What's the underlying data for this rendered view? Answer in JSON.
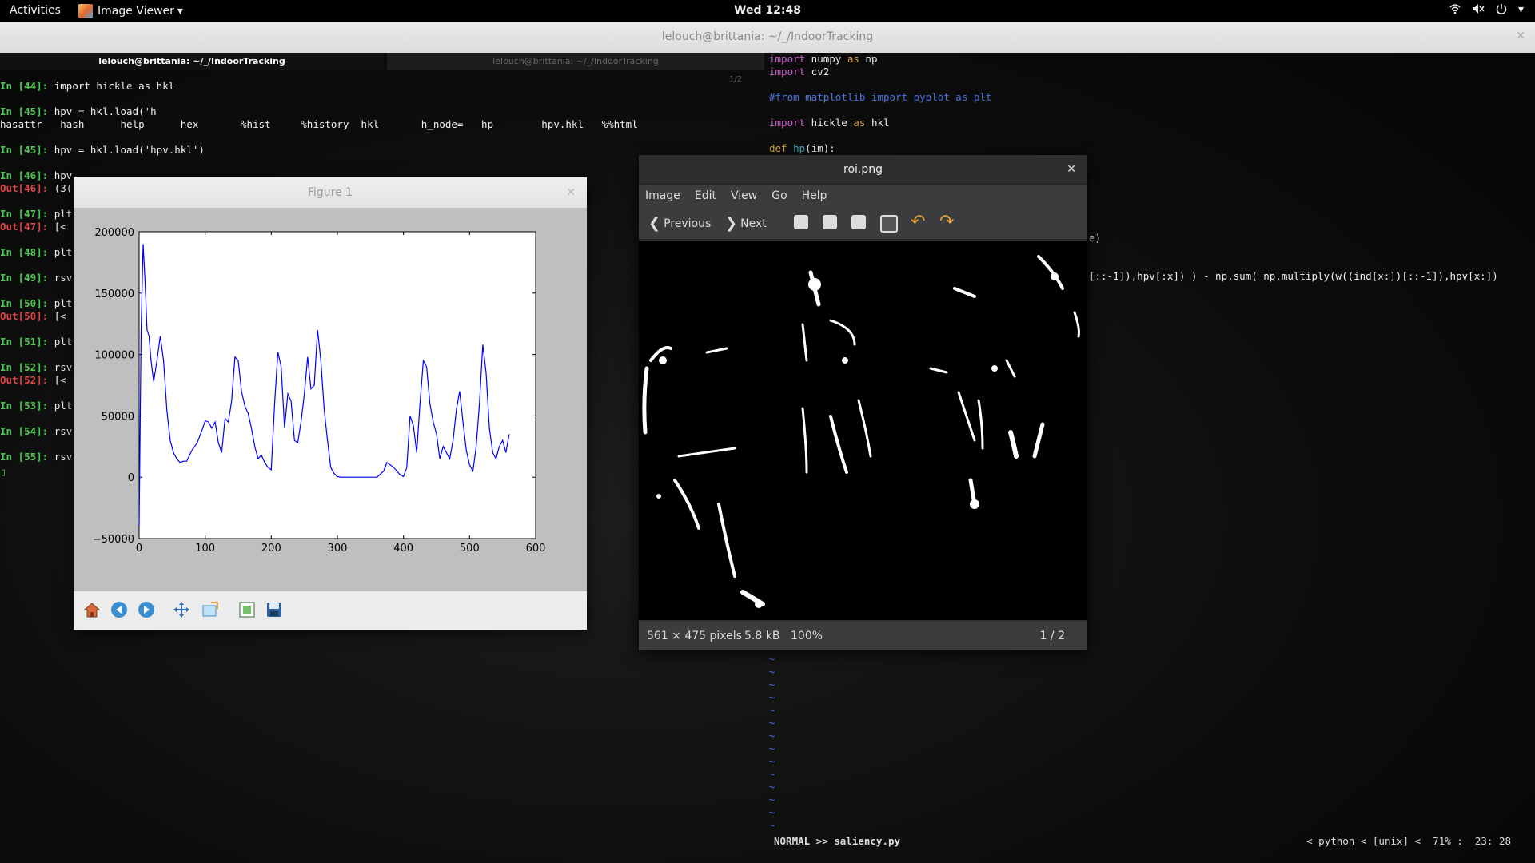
{
  "topbar": {
    "activities": "Activities",
    "app_name": "Image Viewer",
    "app_caret": "▾",
    "clock": "Wed 12:48",
    "icons": [
      "wifi-icon",
      "volume-icon",
      "power-icon"
    ]
  },
  "terminal": {
    "window_title": "lelouch@brittania: ~/_/IndoorTracking",
    "tabs": [
      "lelouch@brittania: ~/_/IndoorTracking",
      "lelouch@brittania: ~/_/IndoorTracking"
    ],
    "tab_counter": "1/2",
    "ipython_lines": [
      {
        "prompt": "In [44]:",
        "kind": "in",
        "text": " import hickle as hkl"
      },
      {
        "prompt": "",
        "kind": "blank",
        "text": ""
      },
      {
        "prompt": "In [45]:",
        "kind": "in",
        "text": " hpv = hkl.load('h"
      },
      {
        "prompt": "",
        "kind": "plain",
        "text": "hasattr   hash      help      hex       %hist     %history  hkl       h_node=   hp        hpv.hkl   %%html"
      },
      {
        "prompt": "",
        "kind": "blank",
        "text": ""
      },
      {
        "prompt": "In [45]:",
        "kind": "in",
        "text": " hpv = hkl.load('hpv.hkl')"
      },
      {
        "prompt": "",
        "kind": "blank",
        "text": ""
      },
      {
        "prompt": "In [46]:",
        "kind": "in",
        "text": " hpv"
      },
      {
        "prompt": "Out[46]:",
        "kind": "out",
        "text": " (3("
      },
      {
        "prompt": "",
        "kind": "blank",
        "text": ""
      },
      {
        "prompt": "In [47]:",
        "kind": "in",
        "text": " plt"
      },
      {
        "prompt": "Out[47]:",
        "kind": "out",
        "text": " [<"
      },
      {
        "prompt": "",
        "kind": "blank",
        "text": ""
      },
      {
        "prompt": "In [48]:",
        "kind": "in",
        "text": " plt"
      },
      {
        "prompt": "",
        "kind": "blank",
        "text": ""
      },
      {
        "prompt": "In [49]:",
        "kind": "in",
        "text": " rsv"
      },
      {
        "prompt": "",
        "kind": "blank",
        "text": ""
      },
      {
        "prompt": "In [50]:",
        "kind": "in",
        "text": " plt"
      },
      {
        "prompt": "Out[50]:",
        "kind": "out",
        "text": " [<"
      },
      {
        "prompt": "",
        "kind": "blank",
        "text": ""
      },
      {
        "prompt": "In [51]:",
        "kind": "in",
        "text": " plt"
      },
      {
        "prompt": "",
        "kind": "blank",
        "text": ""
      },
      {
        "prompt": "In [52]:",
        "kind": "in",
        "text": " rsv"
      },
      {
        "prompt": "Out[52]:",
        "kind": "out",
        "text": " [<"
      },
      {
        "prompt": "",
        "kind": "blank",
        "text": ""
      },
      {
        "prompt": "In [53]:",
        "kind": "in",
        "text": " plt"
      },
      {
        "prompt": "",
        "kind": "blank",
        "text": ""
      },
      {
        "prompt": "In [54]:",
        "kind": "in",
        "text": " rsv"
      },
      {
        "prompt": "",
        "kind": "blank",
        "text": ""
      },
      {
        "prompt": "In [55]:",
        "kind": "in",
        "text": " rsv"
      }
    ],
    "vim_lines": [
      [
        [
          "kw",
          "import"
        ],
        [
          "t",
          " numpy "
        ],
        [
          "def",
          "as"
        ],
        [
          "t",
          " np"
        ]
      ],
      [
        [
          "kw",
          "import"
        ],
        [
          "t",
          " cv2"
        ]
      ],
      [
        [
          "t",
          ""
        ]
      ],
      [
        [
          "cm",
          "#from matplotlib import pyplot as plt"
        ]
      ],
      [
        [
          "t",
          ""
        ]
      ],
      [
        [
          "kw",
          "import"
        ],
        [
          "t",
          " hickle "
        ],
        [
          "def",
          "as"
        ],
        [
          "t",
          " hkl"
        ]
      ],
      [
        [
          "t",
          ""
        ]
      ],
      [
        [
          "def",
          "def"
        ],
        [
          "t",
          " "
        ],
        [
          "fn",
          "hp"
        ],
        [
          "t",
          "(im):"
        ]
      ]
    ],
    "vim_fragment_1": "e)",
    "vim_fragment_2": "[::-1]),hpv[:x]) ) - np.sum( np.multiply(w((ind[x:])[::-1]),hpv[x:])",
    "vim_status_left": "NORMAL >> saliency.py",
    "vim_status_right": "< python < [unix] <  71% :  23: 28",
    "tilde_count": 14
  },
  "figure": {
    "window_title": "Figure 1",
    "toolbar": [
      "home-icon",
      "back-icon",
      "forward-icon",
      "pan-icon",
      "zoom-icon",
      "configure-subplots-icon",
      "save-icon"
    ]
  },
  "chart_data": {
    "type": "line",
    "title": "",
    "xlabel": "",
    "ylabel": "",
    "xlim": [
      0,
      600
    ],
    "ylim": [
      -50000,
      200000
    ],
    "xticks": [
      0,
      100,
      200,
      300,
      400,
      500,
      600
    ],
    "yticks": [
      -50000,
      0,
      50000,
      100000,
      150000,
      200000
    ],
    "series": [
      {
        "color": "#0000ff",
        "x": [
          0,
          3,
          6,
          9,
          12,
          15,
          18,
          22,
          27,
          32,
          37,
          42,
          47,
          52,
          57,
          62,
          67,
          72,
          80,
          88,
          95,
          100,
          105,
          110,
          115,
          120,
          125,
          130,
          135,
          140,
          145,
          150,
          155,
          160,
          165,
          170,
          175,
          180,
          185,
          190,
          195,
          200,
          205,
          210,
          215,
          220,
          225,
          230,
          235,
          240,
          245,
          250,
          255,
          260,
          265,
          270,
          275,
          280,
          285,
          290,
          295,
          300,
          305,
          310,
          315,
          320,
          330,
          345,
          360,
          370,
          375,
          380,
          385,
          390,
          395,
          400,
          405,
          410,
          415,
          420,
          425,
          430,
          435,
          440,
          445,
          450,
          455,
          460,
          465,
          470,
          475,
          480,
          485,
          490,
          495,
          500,
          505,
          510,
          515,
          520,
          525,
          530,
          535,
          540,
          545,
          550,
          555,
          560
        ],
        "y": [
          -40000,
          120000,
          190000,
          160000,
          120000,
          115000,
          95000,
          78000,
          95000,
          115000,
          95000,
          55000,
          30000,
          20000,
          15000,
          12000,
          13000,
          13000,
          22000,
          28000,
          38000,
          46000,
          45000,
          40000,
          45000,
          28000,
          20000,
          48000,
          45000,
          62000,
          98000,
          95000,
          70000,
          58000,
          52000,
          40000,
          25000,
          15000,
          18000,
          12000,
          8000,
          6000,
          60000,
          102000,
          90000,
          40000,
          68000,
          62000,
          30000,
          28000,
          45000,
          68000,
          98000,
          72000,
          75000,
          120000,
          95000,
          55000,
          30000,
          8000,
          3000,
          500,
          0,
          0,
          0,
          0,
          0,
          0,
          0,
          5000,
          12000,
          10000,
          8000,
          5000,
          2000,
          500,
          8000,
          50000,
          42000,
          20000,
          60000,
          95000,
          90000,
          60000,
          45000,
          35000,
          15000,
          25000,
          20000,
          15000,
          30000,
          55000,
          70000,
          45000,
          22000,
          10000,
          5000,
          25000,
          60000,
          108000,
          85000,
          40000,
          20000,
          15000,
          25000,
          30000,
          20000,
          35000
        ]
      }
    ]
  },
  "roi": {
    "window_title": "roi.png",
    "menu": [
      "Image",
      "Edit",
      "View",
      "Go",
      "Help"
    ],
    "previous_label": "Previous",
    "next_label": "Next",
    "dims": "561 × 475 pixels",
    "size": "5.8 kB",
    "zoom": "100%",
    "counter": "1 / 2"
  }
}
